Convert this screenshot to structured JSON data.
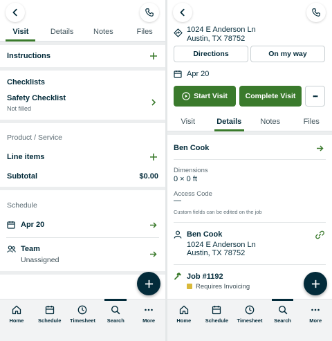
{
  "left": {
    "tabs": [
      "Visit",
      "Details",
      "Notes",
      "Files"
    ],
    "instructions": "Instructions",
    "checklists": {
      "title": "Checklists",
      "item": "Safety Checklist",
      "status": "Not filled"
    },
    "product_service": {
      "title": "Product / Service",
      "line_items": "Line items",
      "subtotal_label": "Subtotal",
      "subtotal_value": "$0.00"
    },
    "schedule": {
      "title": "Schedule",
      "date": "Apr 20",
      "team_label": "Team",
      "team_value": "Unassigned"
    }
  },
  "right": {
    "address_line1": "1024 E Anderson Ln",
    "address_line2": "Austin, TX 78752",
    "directions": "Directions",
    "on_my_way": "On my way",
    "date": "Apr 20",
    "start_visit": "Start Visit",
    "complete_visit": "Complete Visit",
    "more": "•••",
    "tabs": [
      "Visit",
      "Details",
      "Notes",
      "Files"
    ],
    "client_name": "Ben Cook",
    "dimensions_label": "Dimensions",
    "dimensions_value": "0 × 0 ft",
    "access_code_label": "Access Code",
    "access_code_value": "—",
    "custom_fields_note": "Custom fields can be edited on the job",
    "contact": {
      "name": "Ben Cook",
      "line1": "1024 E Anderson Ln",
      "line2": "Austin, TX 78752"
    },
    "job": {
      "title": "Job #1192",
      "status": "Requires Invoicing"
    }
  },
  "nav": [
    "Home",
    "Schedule",
    "Timesheet",
    "Search",
    "More"
  ],
  "colors": {
    "primary_green": "#3a7a2c",
    "navy": "#032b3a",
    "status_yellow": "#d9b93a"
  }
}
